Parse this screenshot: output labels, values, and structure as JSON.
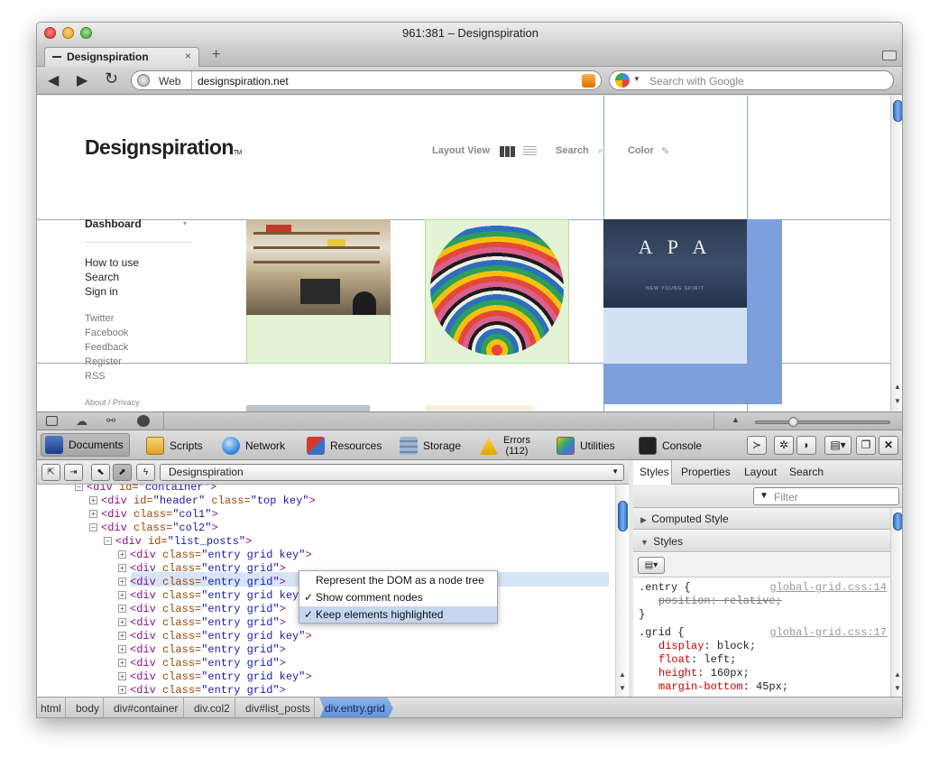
{
  "window": {
    "title": "961:381 – Designspiration"
  },
  "tab": {
    "label": "Designspiration",
    "close": "×",
    "new_tab": "+"
  },
  "nav": {
    "back": "◀",
    "forward": "▶",
    "reload": "↻",
    "mode_label": "Web",
    "url": "designspiration.net",
    "search_placeholder": "Search with Google"
  },
  "site": {
    "logo": "Designspiration",
    "logo_tm": "TM",
    "layout_view_label": "Layout View",
    "search_label": "Search",
    "color_label": "Color",
    "dashboard_label": "Dashboard",
    "primary_links": [
      "How to use",
      "Search",
      "Sign in"
    ],
    "secondary_links": [
      "Twitter",
      "Facebook",
      "Feedback",
      "Register",
      "RSS"
    ],
    "footer_links": "About / Privacy",
    "poster_text": "A P A",
    "poster_sub": "NEW YOUNG SPIRIT"
  },
  "inspector": {
    "tabs": [
      {
        "label": "Documents"
      },
      {
        "label": "Scripts"
      },
      {
        "label": "Network"
      },
      {
        "label": "Resources"
      },
      {
        "label": "Storage"
      },
      {
        "label": "Errors",
        "count": "(112)"
      },
      {
        "label": "Utilities"
      },
      {
        "label": "Console"
      }
    ],
    "document_select": "Designspiration",
    "dom_rows": [
      {
        "indent": 0,
        "toggle": "−",
        "tag": "div",
        "attrs": [
          [
            "id",
            "container"
          ]
        ],
        "partial": true
      },
      {
        "indent": 1,
        "toggle": "+",
        "tag": "div",
        "attrs": [
          [
            "id",
            "header"
          ],
          [
            "class",
            "top key"
          ]
        ]
      },
      {
        "indent": 1,
        "toggle": "+",
        "tag": "div",
        "attrs": [
          [
            "class",
            "col1"
          ]
        ]
      },
      {
        "indent": 1,
        "toggle": "−",
        "tag": "div",
        "attrs": [
          [
            "class",
            "col2"
          ]
        ]
      },
      {
        "indent": 2,
        "toggle": "−",
        "tag": "div",
        "attrs": [
          [
            "id",
            "list_posts"
          ]
        ]
      },
      {
        "indent": 3,
        "toggle": "+",
        "tag": "div",
        "attrs": [
          [
            "class",
            "entry grid key"
          ]
        ]
      },
      {
        "indent": 3,
        "toggle": "+",
        "tag": "div",
        "attrs": [
          [
            "class",
            "entry grid"
          ]
        ]
      },
      {
        "indent": 3,
        "toggle": "+",
        "tag": "div",
        "attrs": [
          [
            "class",
            "entry grid"
          ]
        ],
        "selected": true
      },
      {
        "indent": 3,
        "toggle": "+",
        "tag": "div",
        "attrs": [
          [
            "class",
            "entry grid key"
          ]
        ]
      },
      {
        "indent": 3,
        "toggle": "+",
        "tag": "div",
        "attrs": [
          [
            "class",
            "entry grid"
          ]
        ]
      },
      {
        "indent": 3,
        "toggle": "+",
        "tag": "div",
        "attrs": [
          [
            "class",
            "entry grid"
          ]
        ]
      },
      {
        "indent": 3,
        "toggle": "+",
        "tag": "div",
        "attrs": [
          [
            "class",
            "entry grid key"
          ]
        ]
      },
      {
        "indent": 3,
        "toggle": "+",
        "tag": "div",
        "attrs": [
          [
            "class",
            "entry grid"
          ]
        ]
      },
      {
        "indent": 3,
        "toggle": "+",
        "tag": "div",
        "attrs": [
          [
            "class",
            "entry grid"
          ]
        ]
      },
      {
        "indent": 3,
        "toggle": "+",
        "tag": "div",
        "attrs": [
          [
            "class",
            "entry grid key"
          ]
        ]
      },
      {
        "indent": 3,
        "toggle": "+",
        "tag": "div",
        "attrs": [
          [
            "class",
            "entry grid"
          ]
        ]
      }
    ],
    "context_menu": [
      {
        "label": "Represent the DOM as a node tree",
        "checked": false
      },
      {
        "label": "Show comment nodes",
        "checked": true
      },
      {
        "label": "Keep elements highlighted",
        "checked": true,
        "highlighted": true
      }
    ],
    "style_tabs": [
      "Styles",
      "Properties",
      "Layout",
      "Search"
    ],
    "filter_placeholder": "Filter",
    "computed_style_label": "Computed Style",
    "styles_label": "Styles",
    "rules": [
      {
        "selector": ".entry",
        "source": "global-grid.css:14",
        "declarations": [
          {
            "prop": "position",
            "value": "relative",
            "struck": true
          }
        ]
      },
      {
        "selector": ".grid",
        "source": "global-grid.css:17",
        "declarations": [
          {
            "prop": "display",
            "value": "block"
          },
          {
            "prop": "float",
            "value": "left"
          },
          {
            "prop": "height",
            "value": "160px"
          },
          {
            "prop": "margin-bottom",
            "value": "45px"
          }
        ]
      }
    ],
    "breadcrumb": [
      "html",
      "body",
      "div#container",
      "div.col2",
      "div#list_posts",
      "div.entry.grid"
    ]
  }
}
